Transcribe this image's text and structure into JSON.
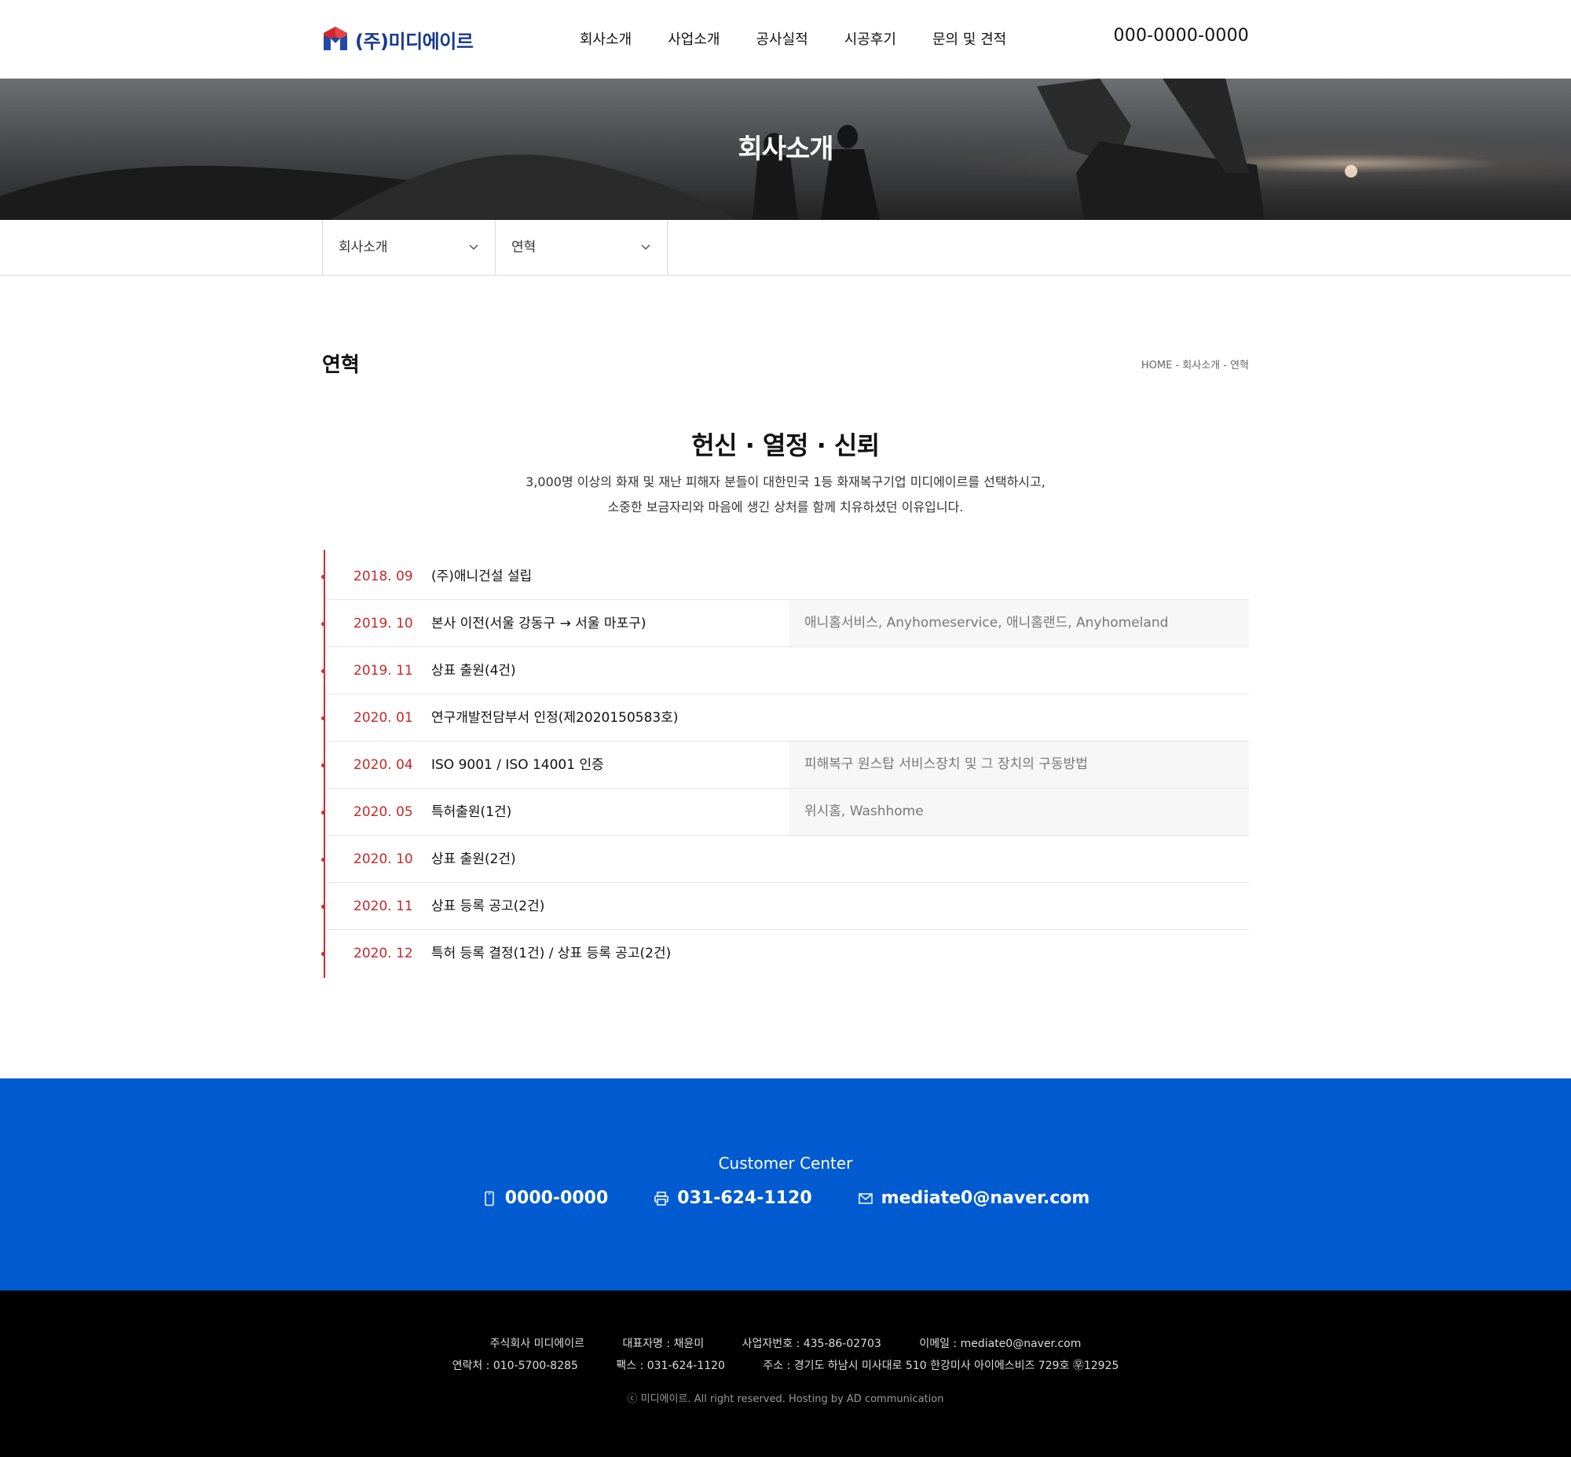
{
  "header": {
    "logo_text": "(주)미디에이르",
    "nav": [
      "회사소개",
      "사업소개",
      "공사실적",
      "시공후기",
      "문의 및 견적"
    ],
    "phone": "000-0000-0000"
  },
  "banner": {
    "title": "회사소개"
  },
  "subnav": {
    "first": "회사소개",
    "second": "연혁"
  },
  "page": {
    "title": "연혁",
    "breadcrumb": "HOME - 회사소개 - 연혁",
    "slogan": "헌신 · 열정 · 신뢰",
    "intro_line1": "3,000명 이상의 화재 및 재난 피해자 분들이 대한민국 1등 화재복구기업 미디에이르를 선택하시고,",
    "intro_line2": "소중한 보금자리와 마음에 생긴 상처를 함께 치유하셨던 이유입니다."
  },
  "timeline": [
    {
      "date": "2018. 09",
      "text": "(주)애니건설 설립",
      "note": ""
    },
    {
      "date": "2019. 10",
      "text": "본사 이전(서울 강동구 → 서울 마포구)",
      "note": "애니홈서비스, Anyhomeservice, 애니홈랜드, Anyhomeland"
    },
    {
      "date": "2019. 11",
      "text": "상표 출원(4건)",
      "note": ""
    },
    {
      "date": "2020. 01",
      "text": "연구개발전담부서 인정(제2020150583호)",
      "note": ""
    },
    {
      "date": "2020. 04",
      "text": "ISO 9001 / ISO 14001 인증",
      "note": "피해복구 원스탑 서비스장치 및 그 장치의 구동방법"
    },
    {
      "date": "2020. 05",
      "text": "특허출원(1건)",
      "note": "위시홈, Washhome"
    },
    {
      "date": "2020. 10",
      "text": "상표 출원(2건)",
      "note": ""
    },
    {
      "date": "2020. 11",
      "text": "상표 등록 공고(2건)",
      "note": ""
    },
    {
      "date": "2020. 12",
      "text": "특허 등록 결정(1건) / 상표 등록 공고(2건)",
      "note": ""
    }
  ],
  "customer_center": {
    "title": "Customer Center",
    "phone": "0000-0000",
    "fax": "031-624-1120",
    "email": "mediate0@naver.com",
    "icons": [
      "mobile-icon",
      "printer-icon",
      "mail-icon"
    ]
  },
  "footer": {
    "company": "주식회사 미디에이르",
    "ceo": "대표자명 : 채윤미",
    "biz_no": "사업자번호 : 435-86-02703",
    "email": "이메일 : mediate0@naver.com",
    "contact": "연락처 : 010-5700-8285",
    "fax": "팩스 : 031-624-1120",
    "address": "주소 : 경기도 하남시 미사대로 510 한강미사 아이에스비즈 729호 ㉾12925",
    "copyright": "ⓒ 미디에이르. All right reserved. Hosting by AD communication"
  },
  "colors": {
    "brand_blue": "#005bd0",
    "accent_red": "#c8282a",
    "logo_navy": "#1a3a8c",
    "footer_black": "#000000"
  }
}
